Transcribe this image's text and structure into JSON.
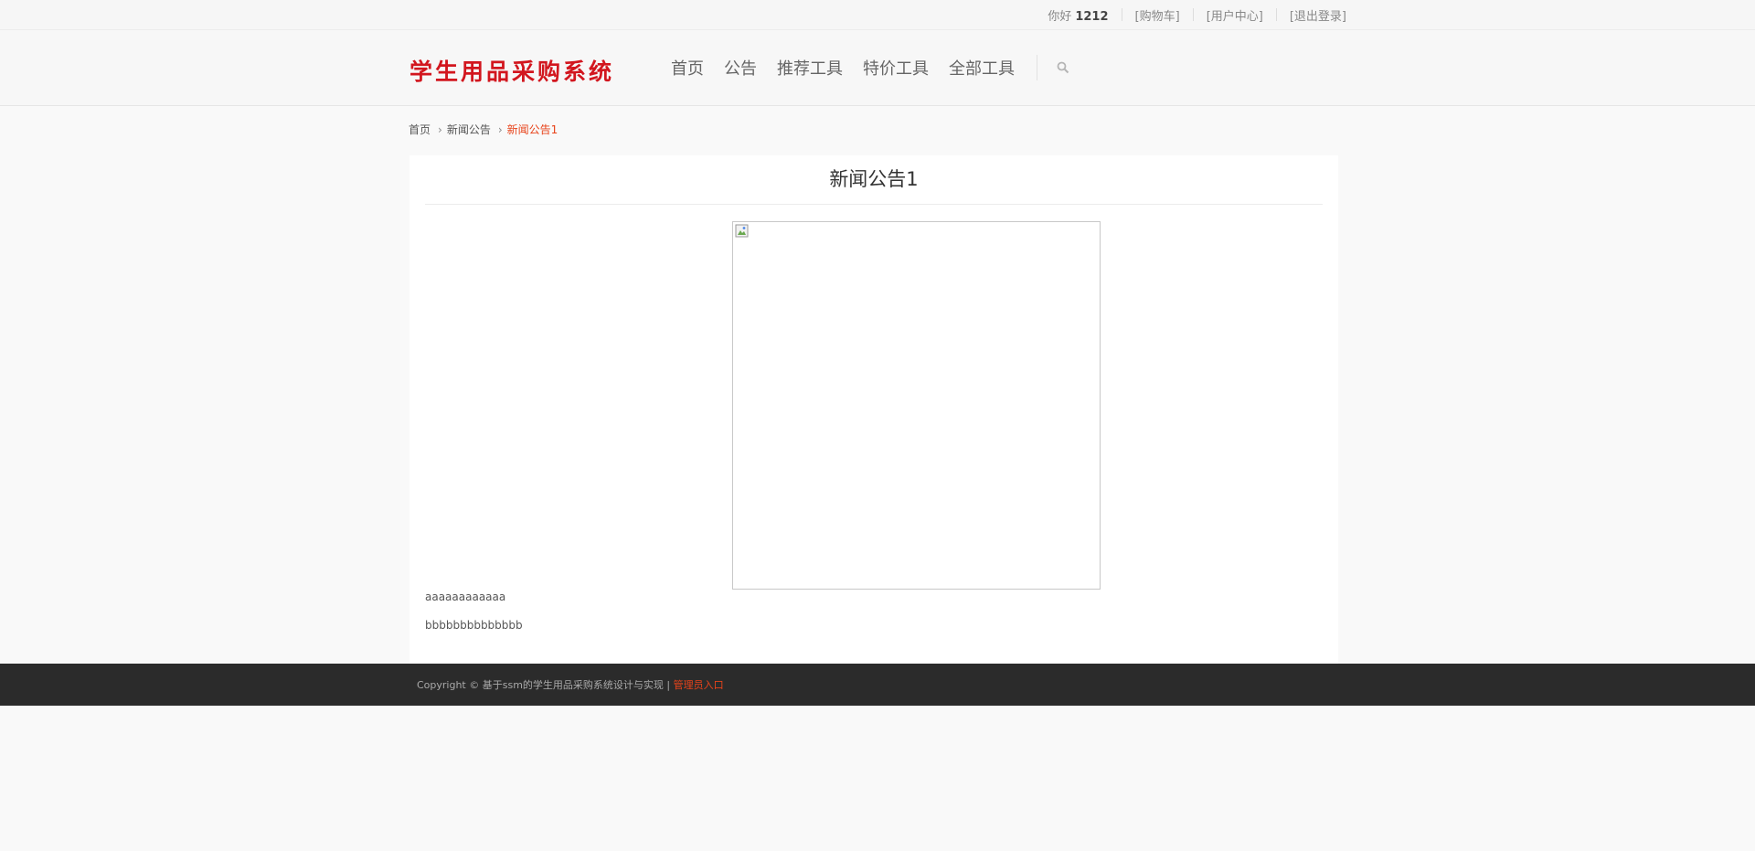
{
  "topbar": {
    "greeting": "你好",
    "username": "1212",
    "links": [
      "[购物车]",
      "[用户中心]",
      "[退出登录]"
    ]
  },
  "header": {
    "logo": "学生用品采购系统",
    "nav": [
      "首页",
      "公告",
      "推荐工具",
      "特价工具",
      "全部工具"
    ],
    "search_icon": "search-icon"
  },
  "breadcrumb": {
    "items": [
      "首页",
      "新闻公告",
      "新闻公告1"
    ]
  },
  "article": {
    "title": "新闻公告1",
    "image_icon": "broken-image-icon",
    "paragraphs": [
      "aaaaaaaaaaaa",
      "bbbbbbbbbbbbbb"
    ]
  },
  "footer": {
    "copyright": "Copyright © 基于ssm的学生用品采购系统设计与实现 |",
    "admin_link": "管理员入口"
  },
  "colors": {
    "accent": "#e8431a",
    "logo": "#d2161e",
    "footer_bg": "#2b2b2b"
  }
}
